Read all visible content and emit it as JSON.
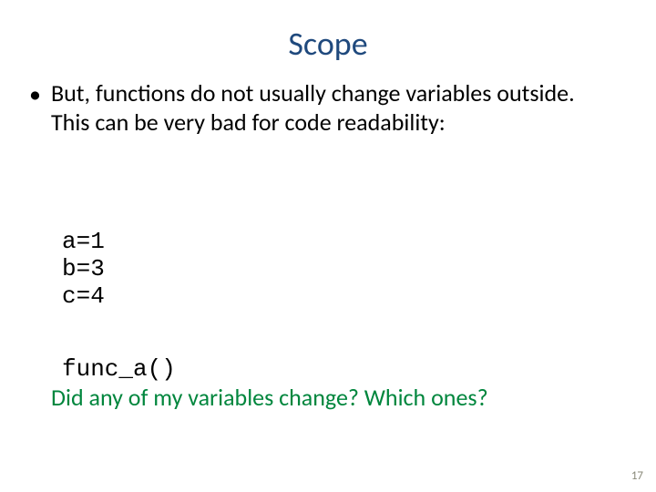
{
  "title": "Scope",
  "bullet": {
    "marker": "•",
    "text": "But, functions do not usually change variables outside. This can be very bad for code readability:"
  },
  "code": {
    "assignments": "a=1\nb=3\nc=4",
    "call": "func_a()"
  },
  "question": "Did any of my variables change? Which ones?",
  "page_number": "17"
}
